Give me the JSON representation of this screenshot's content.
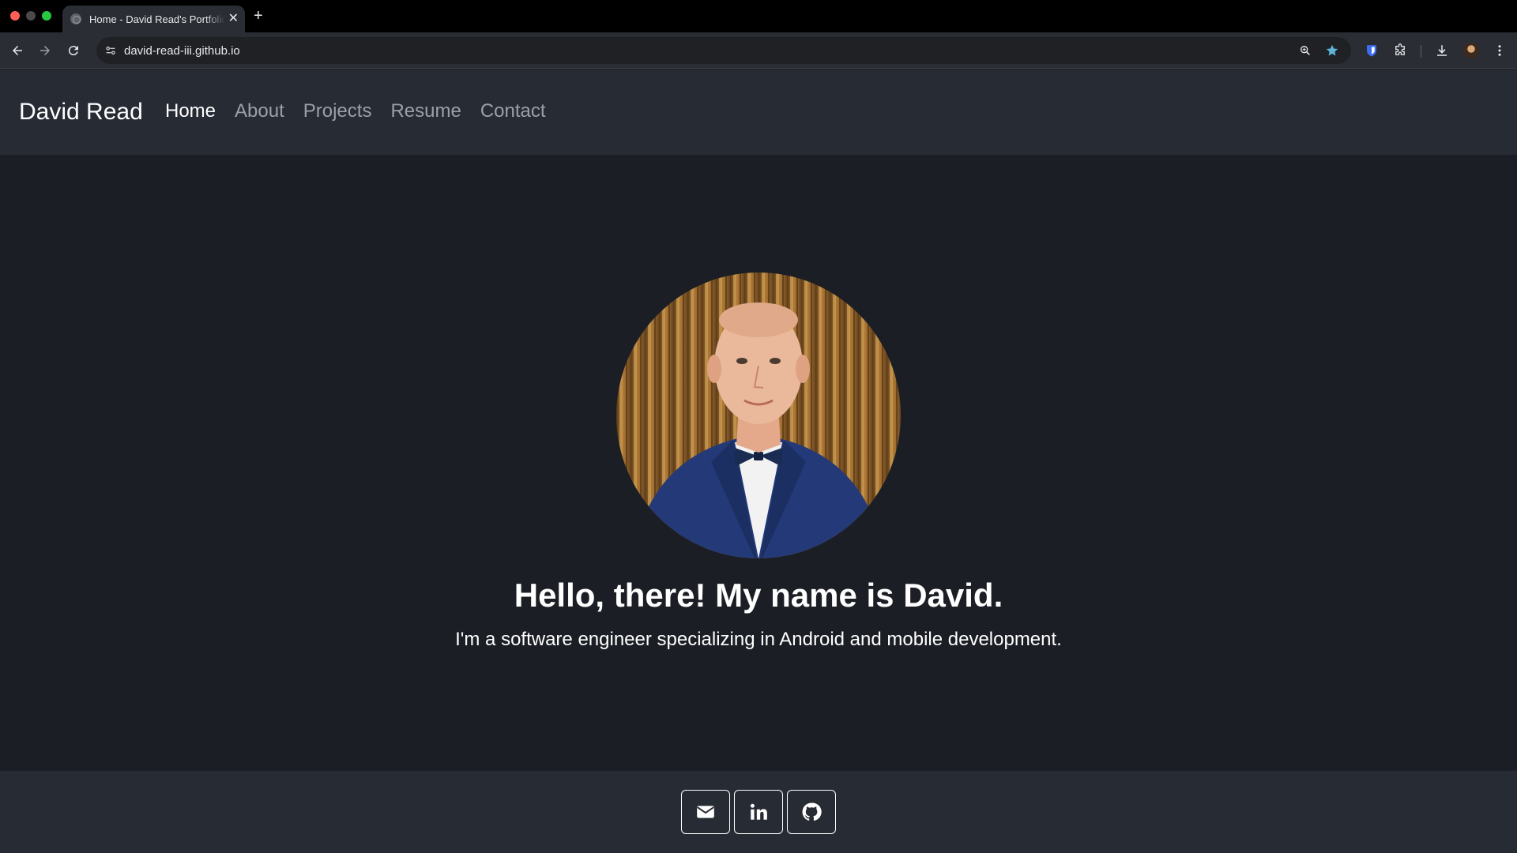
{
  "browser": {
    "tab_title": "Home - David Read's Portfolio",
    "tab_close": "✕",
    "new_tab": "+",
    "url": "david-read-iii.github.io",
    "star_color": "#5fb3d9",
    "shield_color": "#3b6ef5"
  },
  "site": {
    "brand": "David Read",
    "nav": [
      {
        "label": "Home",
        "active": true
      },
      {
        "label": "About",
        "active": false
      },
      {
        "label": "Projects",
        "active": false
      },
      {
        "label": "Resume",
        "active": false
      },
      {
        "label": "Contact",
        "active": false
      }
    ]
  },
  "hero": {
    "title": "Hello, there! My name is David.",
    "subtitle": "I'm a software engineer specializing in Android and mobile development."
  },
  "footer": {
    "links": [
      "email-icon",
      "linkedin-icon",
      "github-icon"
    ]
  },
  "colors": {
    "page_bg": "#1b1e24",
    "nav_bg": "#272b34",
    "nav_inactive": "#9ca0a6",
    "text": "#ffffff"
  }
}
